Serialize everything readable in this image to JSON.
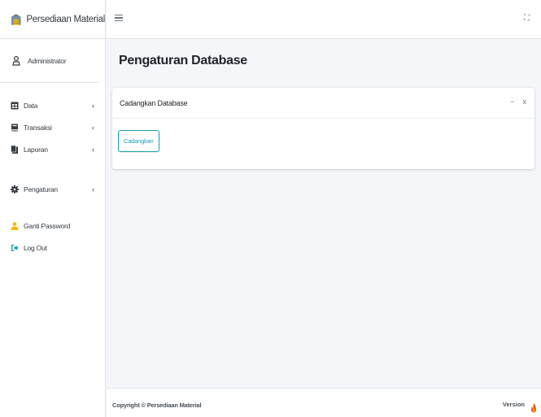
{
  "brand": {
    "title": "Persediaan Material"
  },
  "user": {
    "name": "Administrator"
  },
  "sidebar": {
    "items": [
      {
        "label": "Data",
        "icon": "table-icon",
        "has_children": true
      },
      {
        "label": "Transaksi",
        "icon": "book-icon",
        "has_children": true
      },
      {
        "label": "Laporan",
        "icon": "clipboard-icon",
        "has_children": true
      },
      {
        "label": "Pengaturan",
        "icon": "cog-icon",
        "has_children": true
      },
      {
        "label": "Ganti Password",
        "icon": "user-icon",
        "has_children": false
      },
      {
        "label": "Log Out",
        "icon": "sign-out-icon",
        "has_children": false
      }
    ],
    "chevron": "‹"
  },
  "topbar": {
    "menu_icon": "hamburger-icon",
    "fullscreen_icon": "expand-icon",
    "fullscreen_glyph": "⛶"
  },
  "page": {
    "title": "Pengaturan Database"
  },
  "card": {
    "title": "Cadangkan Database",
    "collapse_glyph": "−",
    "close_glyph": "x",
    "button_label": "Cadangkan"
  },
  "footer": {
    "copyright": "Copyright © Persediaan Material",
    "version": "Version"
  },
  "colors": {
    "accent": "#17a2b8",
    "sidebar_bg": "#ffffff",
    "content_bg": "#f4f6f9",
    "user_icon": "#f5b800",
    "logout_icon": "#17a2b8"
  }
}
